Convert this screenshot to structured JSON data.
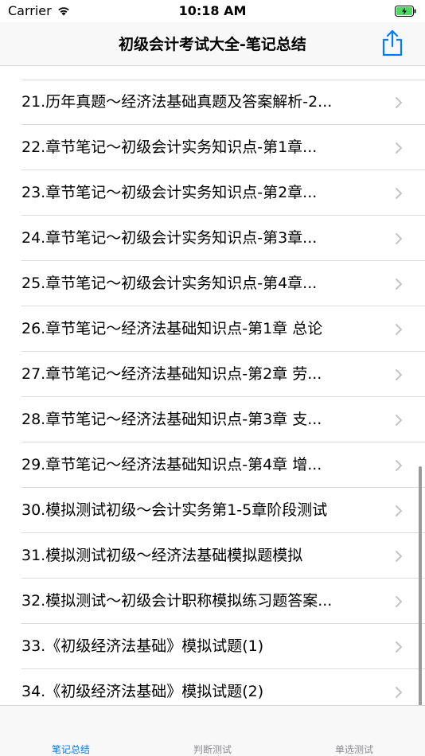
{
  "status_bar": {
    "carrier": "Carrier",
    "time": "10:18 AM"
  },
  "nav": {
    "title": "初级会计考试大全-笔记总结",
    "share_icon": "share-icon"
  },
  "colors": {
    "accent": "#007aff",
    "battery_green": "#4cd964"
  },
  "list": {
    "items": [
      {
        "label": "21.历年真题～经济法基础真题及答案解析-2..."
      },
      {
        "label": "22.章节笔记～初级会计实务知识点-第1章..."
      },
      {
        "label": "23.章节笔记～初级会计实务知识点-第2章..."
      },
      {
        "label": "24.章节笔记～初级会计实务知识点-第3章..."
      },
      {
        "label": "25.章节笔记～初级会计实务知识点-第4章..."
      },
      {
        "label": "26.章节笔记～经济法基础知识点-第1章 总论"
      },
      {
        "label": "27.章节笔记～经济法基础知识点-第2章 劳..."
      },
      {
        "label": "28.章节笔记～经济法基础知识点-第3章 支..."
      },
      {
        "label": "29.章节笔记～经济法基础知识点-第4章 增..."
      },
      {
        "label": "30.模拟测试初级～会计实务第1-5章阶段测试"
      },
      {
        "label": "31.模拟测试初级～经济法基础模拟题模拟"
      },
      {
        "label": "32.模拟测试～初级会计职称模拟练习题答案..."
      },
      {
        "label": "33.《初级经济法基础》模拟试题(1)"
      },
      {
        "label": "34.《初级经济法基础》模拟试题(2)"
      }
    ]
  },
  "tabs": [
    {
      "label": "笔记总结",
      "active": true
    },
    {
      "label": "判断测试",
      "active": false
    },
    {
      "label": "单选测试",
      "active": false
    }
  ]
}
